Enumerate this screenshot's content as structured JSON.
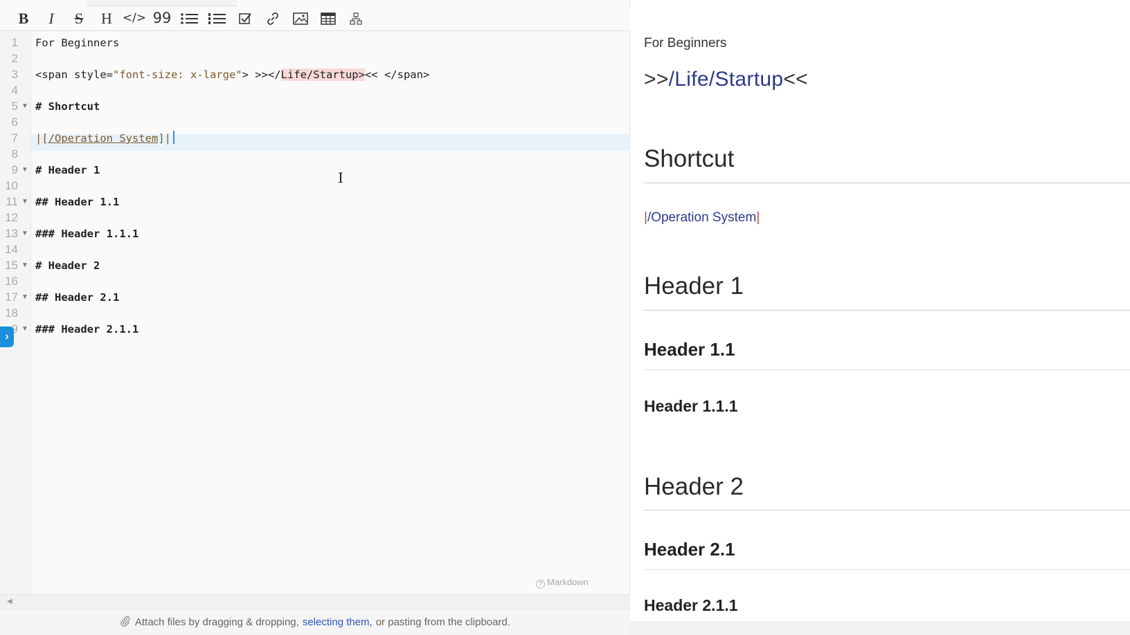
{
  "toolbar": {
    "buttons": [
      {
        "name": "bold-button",
        "icon": "bold-icon",
        "glyph": "B"
      },
      {
        "name": "italic-button",
        "icon": "italic-icon",
        "glyph": "I"
      },
      {
        "name": "strikethrough-button",
        "icon": "strikethrough-icon",
        "glyph": "S"
      },
      {
        "name": "heading-button",
        "icon": "heading-icon",
        "glyph": "H"
      },
      {
        "name": "code-button",
        "icon": "code-icon",
        "glyph": "</>"
      },
      {
        "name": "quote-button",
        "icon": "quote-icon",
        "glyph": "99"
      },
      {
        "name": "bullet-list-button",
        "icon": "bullet-list-icon",
        "glyph": ""
      },
      {
        "name": "numbered-list-button",
        "icon": "numbered-list-icon",
        "glyph": ""
      },
      {
        "name": "task-list-button",
        "icon": "checkbox-icon",
        "glyph": ""
      },
      {
        "name": "link-button",
        "icon": "link-icon",
        "glyph": ""
      },
      {
        "name": "image-button",
        "icon": "image-icon",
        "glyph": ""
      },
      {
        "name": "table-button",
        "icon": "table-icon",
        "glyph": ""
      },
      {
        "name": "diagram-button",
        "icon": "diagram-icon",
        "glyph": ""
      }
    ]
  },
  "editor": {
    "line_numbers": [
      "1",
      "2",
      "3",
      "4",
      "5",
      "6",
      "7",
      "8",
      "9",
      "10",
      "11",
      "12",
      "13",
      "14",
      "15",
      "16",
      "17",
      "18",
      "9"
    ],
    "lines": {
      "l1": "For Beginners",
      "l3_open": "<span style=",
      "l3_attr": "\"font-size: x-large\"",
      "l3_mid": "> >></",
      "l3_link": "Life/Startup>",
      "l3_close": "<< </span>",
      "l5": "# Shortcut",
      "l7_pre": "|[",
      "l7_link": "/Operation System",
      "l7_post": "]|",
      "l9": "# Header 1",
      "l11": "## Header 1.1",
      "l13": "### Header 1.1.1",
      "l15": "# Header 2",
      "l17": "## Header 2.1",
      "l19": "### Header 2.1.1"
    },
    "mode_label": "Markdown",
    "mode_help_glyph": "?"
  },
  "attach_bar": {
    "prefix": "Attach files by dragging & dropping,",
    "link": "selecting them,",
    "suffix": "or pasting from the clipboard."
  },
  "preview": {
    "plain": "For Beginners",
    "big_prefix": ">>",
    "big_link": "/Life/Startup",
    "big_suffix": "<<",
    "h_shortcut": "Shortcut",
    "link_bar_left": "|",
    "link_text": "/Operation System",
    "link_bar_right": "|",
    "h1": "Header 1",
    "h11": "Header 1.1",
    "h111": "Header 1.1.1",
    "h2": "Header 2",
    "h21": "Header 2.1",
    "h211": "Header 2.1.1"
  }
}
